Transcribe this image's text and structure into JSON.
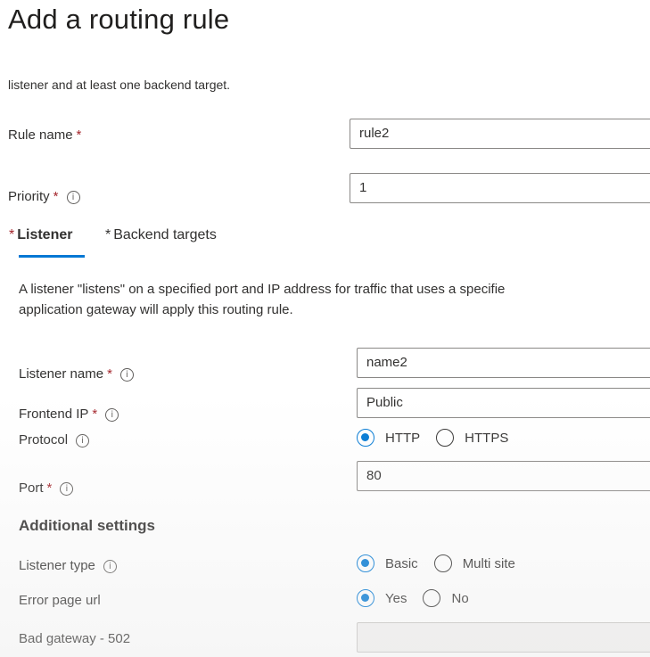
{
  "page": {
    "title": "Add a routing rule",
    "description": "listener and at least one backend target."
  },
  "rule_name": {
    "label": "Rule name",
    "required": "*",
    "value": "rule2"
  },
  "priority": {
    "label": "Priority",
    "required": "*",
    "value": "1",
    "info_icon": "info-icon"
  },
  "tabs": [
    {
      "label": "Listener",
      "required": "*",
      "active": true
    },
    {
      "label": "Backend targets",
      "required": "*",
      "active": false
    }
  ],
  "listener_desc": {
    "line1": "A listener \"listens\" on a specified port and IP address for traffic that uses a specifie",
    "line2": "application gateway will apply this routing rule."
  },
  "listener_name": {
    "label": "Listener name",
    "required": "*",
    "value": "name2"
  },
  "frontend_ip": {
    "label": "Frontend IP",
    "required": "*",
    "value": "Public"
  },
  "protocol": {
    "label": "Protocol",
    "options": [
      "HTTP",
      "HTTPS"
    ],
    "selected": "HTTP"
  },
  "port": {
    "label": "Port",
    "required": "*",
    "value": "80"
  },
  "additional_settings": {
    "title": "Additional settings",
    "listener_type": {
      "label": "Listener type",
      "options": [
        "Basic",
        "Multi site"
      ],
      "selected": "Basic"
    },
    "error_page_url": {
      "label": "Error page url",
      "options": [
        "Yes",
        "No"
      ],
      "selected": "Yes"
    },
    "bad_gateway": {
      "label": "Bad gateway - 502",
      "value": ""
    }
  },
  "colors": {
    "accent": "#0078d4",
    "required": "#a4262c",
    "text": "#323130"
  }
}
